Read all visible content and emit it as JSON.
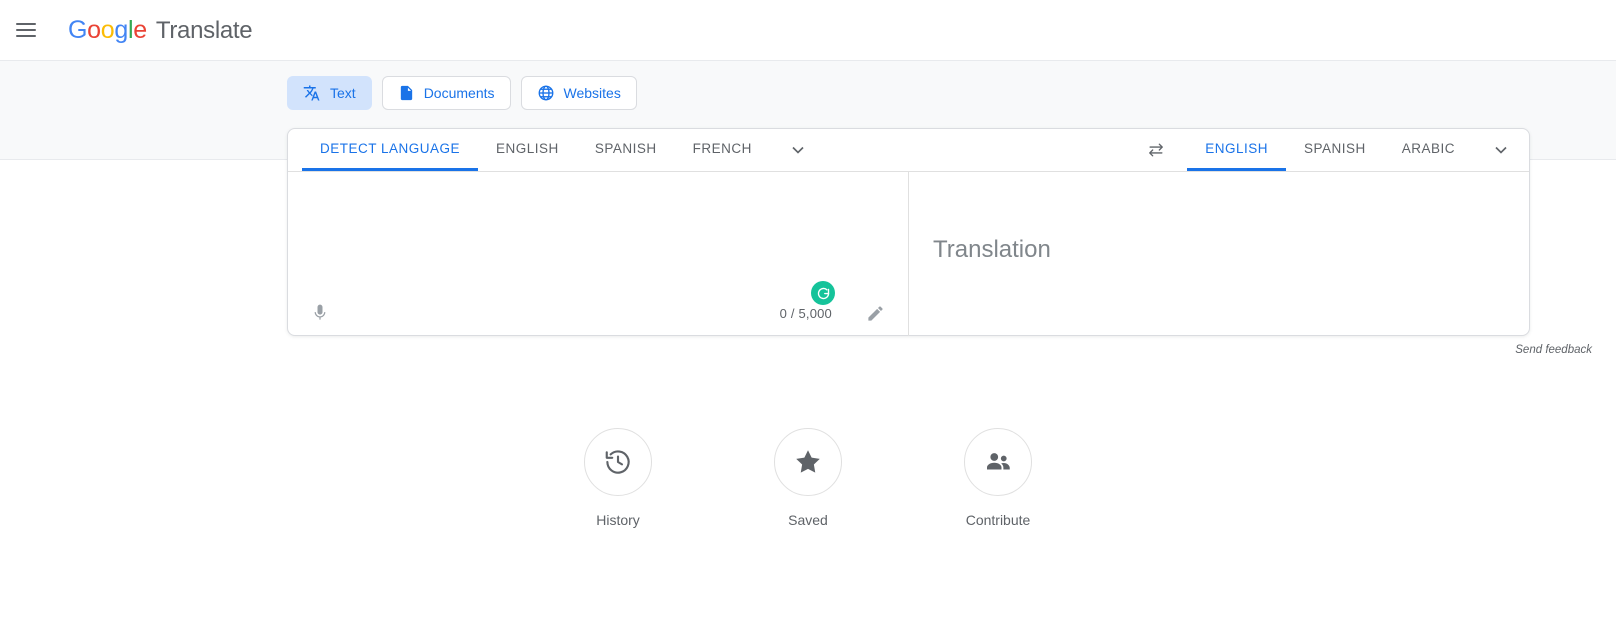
{
  "header": {
    "menu_icon": "hamburger-menu-icon",
    "logo_letters": [
      "G",
      "o",
      "o",
      "g",
      "l",
      "e"
    ],
    "product_name": "Translate"
  },
  "modes": [
    {
      "label": "Text",
      "icon": "translate-icon",
      "active": true
    },
    {
      "label": "Documents",
      "icon": "document-icon",
      "active": false
    },
    {
      "label": "Websites",
      "icon": "globe-icon",
      "active": false
    }
  ],
  "source": {
    "tabs": [
      {
        "label": "DETECT LANGUAGE",
        "active": true
      },
      {
        "label": "ENGLISH",
        "active": false
      },
      {
        "label": "SPANISH",
        "active": false
      },
      {
        "label": "FRENCH",
        "active": false
      }
    ],
    "more_icon": "chevron-down-icon",
    "textarea_value": "",
    "textarea_placeholder": "",
    "mic_icon": "microphone-icon",
    "char_counter": "0 / 5,000",
    "handwriting_icon": "pencil-icon",
    "grammarly_icon": "grammarly-icon"
  },
  "swap": {
    "icon": "swap-languages-icon"
  },
  "target": {
    "tabs": [
      {
        "label": "ENGLISH",
        "active": true
      },
      {
        "label": "SPANISH",
        "active": false
      },
      {
        "label": "ARABIC",
        "active": false
      }
    ],
    "more_icon": "chevron-down-icon",
    "placeholder": "Translation"
  },
  "feedback": {
    "label": "Send feedback"
  },
  "quick_actions": [
    {
      "label": "History",
      "icon": "history-clock-icon"
    },
    {
      "label": "Saved",
      "icon": "star-icon"
    },
    {
      "label": "Contribute",
      "icon": "people-icon"
    }
  ],
  "colors": {
    "accent_blue": "#1a73e8",
    "active_chip_bg": "#d2e3fc",
    "band_bg": "#f8f9fa",
    "grammarly_green": "#15c39a",
    "muted_text": "#5f6368"
  }
}
